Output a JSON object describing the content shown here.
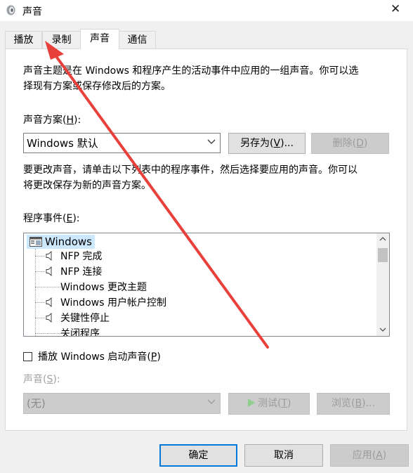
{
  "window": {
    "title": "声音",
    "close_glyph": "✕"
  },
  "tabs": [
    {
      "label": "播放"
    },
    {
      "label": "录制"
    },
    {
      "label": "声音"
    },
    {
      "label": "通信"
    }
  ],
  "intro_lines": [
    "声音主题是在 Windows 和程序产生的活动事件中应用的一组声音。你可以选",
    "择现有方案或保存修改后的方案。"
  ],
  "scheme": {
    "label_prefix": "声音方案(",
    "label_key": "H",
    "label_suffix": "):",
    "selected": "Windows 默认",
    "save_as_prefix": "另存为(",
    "save_as_key": "V",
    "save_as_suffix": ")...",
    "delete_prefix": "删除(",
    "delete_key": "D",
    "delete_suffix": ")"
  },
  "change_lines": [
    "要更改声音，请单击以下列表中的程序事件，然后选择要应用的声音。你可以",
    "将更改保存为新的声音方案。"
  ],
  "events": {
    "label_prefix": "程序事件(",
    "label_key": "E",
    "label_suffix": "):",
    "root": "Windows",
    "items": [
      {
        "label": "NFP 完成",
        "has_sound": true
      },
      {
        "label": "NFP 连接",
        "has_sound": true
      },
      {
        "label": "Windows 更改主题",
        "has_sound": false
      },
      {
        "label": "Windows 用户帐户控制",
        "has_sound": true
      },
      {
        "label": "关键性停止",
        "has_sound": true
      },
      {
        "label": "关闭程序",
        "has_sound": false
      }
    ]
  },
  "startup_sound": {
    "label_prefix": "播放 Windows 启动声音(",
    "label_key": "P",
    "label_suffix": ")",
    "checked": false
  },
  "sound": {
    "label_prefix": "声音(",
    "label_key": "S",
    "label_suffix": "):",
    "selected": "(无)",
    "test_prefix": "测试(",
    "test_key": "T",
    "test_suffix": ")",
    "browse_prefix": "浏览(",
    "browse_key": "B",
    "browse_suffix": ")..."
  },
  "footer": {
    "ok": "确定",
    "cancel": "取消",
    "apply_prefix": "应用(",
    "apply_key": "A",
    "apply_suffix": ")"
  },
  "colors": {
    "accent": "#0078d7",
    "annotation_arrow": "#e8413b",
    "selection": "#cce8ff"
  }
}
